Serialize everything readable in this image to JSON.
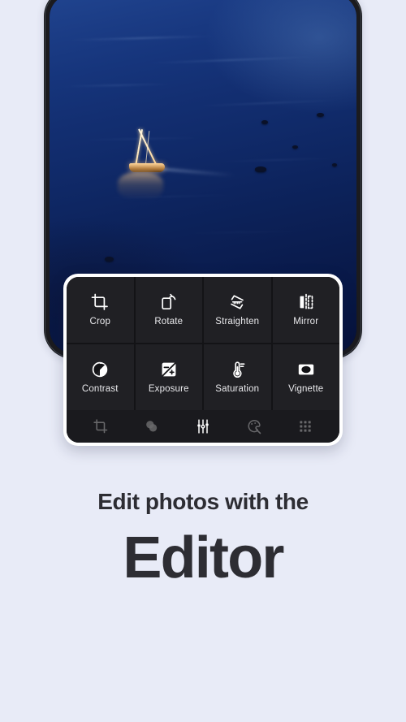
{
  "theme": {
    "background": "#e8ebf7",
    "panel_border": "#ffffff",
    "panel_bg": "#131316",
    "tool_cell_bg": "#202024",
    "bottom_bar_bg": "#1a1a1e",
    "text_color": "#2d2d33",
    "icon_color": "#ffffff"
  },
  "phone": {
    "frame_color": "#1b1b1f",
    "photo_alt": "night-ocean-sailboat-photo"
  },
  "editor": {
    "tools": [
      {
        "label": "Crop",
        "icon": "crop-icon"
      },
      {
        "label": "Rotate",
        "icon": "rotate-icon"
      },
      {
        "label": "Straighten",
        "icon": "straighten-icon"
      },
      {
        "label": "Mirror",
        "icon": "mirror-icon"
      },
      {
        "label": "Contrast",
        "icon": "contrast-icon"
      },
      {
        "label": "Exposure",
        "icon": "exposure-icon"
      },
      {
        "label": "Saturation",
        "icon": "saturation-icon"
      },
      {
        "label": "Vignette",
        "icon": "vignette-icon"
      }
    ],
    "bottom_bar": [
      {
        "icon": "crop-tab-icon",
        "active": false
      },
      {
        "icon": "filters-tab-icon",
        "active": false
      },
      {
        "icon": "adjust-tab-icon",
        "active": true
      },
      {
        "icon": "effects-tab-icon",
        "active": false
      },
      {
        "icon": "grid-tab-icon",
        "active": false
      }
    ]
  },
  "caption": {
    "line1": "Edit photos with the",
    "line2": "Editor"
  }
}
